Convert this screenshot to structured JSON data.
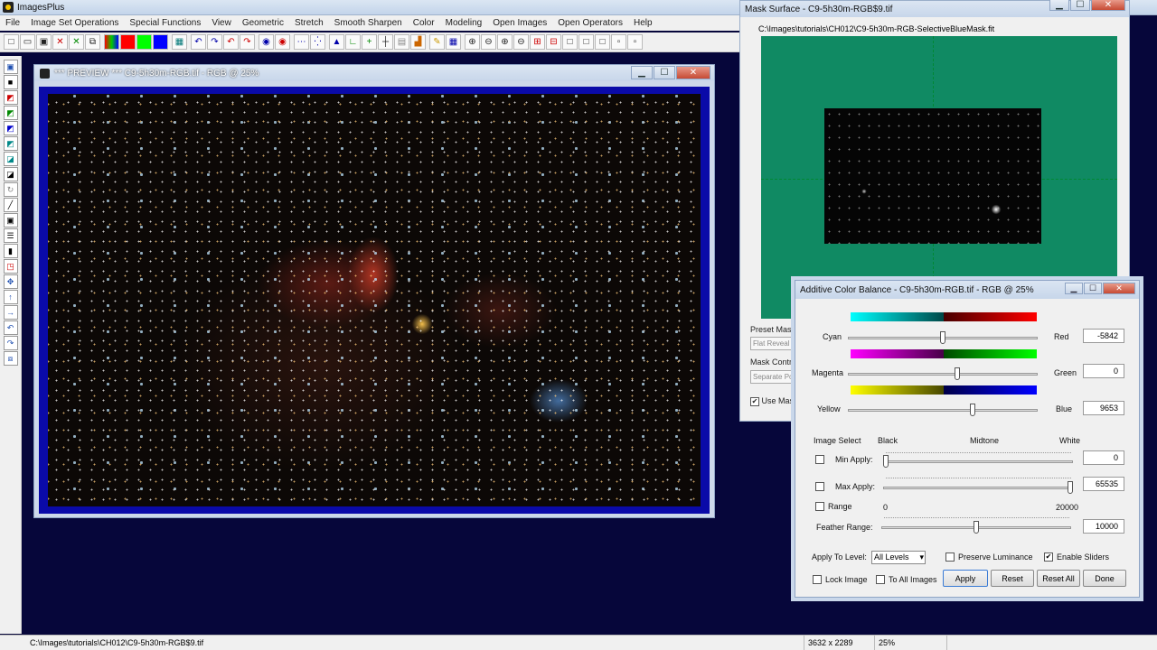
{
  "app": {
    "title": "ImagesPlus"
  },
  "menu": [
    "File",
    "Image Set Operations",
    "Special Functions",
    "View",
    "Geometric",
    "Stretch",
    "Smooth Sharpen",
    "Color",
    "Modeling",
    "Open Images",
    "Open Operators",
    "Help"
  ],
  "preview_window": {
    "title": "*** PREVIEW *** C9-5h30m-RGB.tif - RGB @ 25%",
    "controls": {
      "minimize": "▁",
      "maximize": "☐",
      "close": "✕"
    }
  },
  "mask_window": {
    "title": "Mask Surface - C9-5h30m-RGB$9.tif",
    "path": "C:\\Images\\tutorials\\CH012\\C9-5h30m-RGB-SelectiveBlueMask.fit",
    "preset_label": "Preset Mask",
    "preset_value": "Flat Reveal",
    "control_label": "Mask Control",
    "control_value": "Separate Po",
    "use_mask_label": "Use Mask",
    "use_mask_checked": "✔"
  },
  "color_balance": {
    "title": "Additive Color Balance - C9-5h30m-RGB.tif - RGB @ 25%",
    "controls": {
      "minimize": "▁",
      "maximize": "☐",
      "close": "✕"
    },
    "sliders": [
      {
        "left": "Cyan",
        "right": "Red",
        "value": "-5842",
        "level": 0.5
      },
      {
        "left": "Magenta",
        "right": "Green",
        "value": "0",
        "level": 0.58
      },
      {
        "left": "Yellow",
        "right": "Blue",
        "value": "9653",
        "level": 0.66
      }
    ],
    "image_select": "Image Select",
    "black": "Black",
    "midtone": "Midtone",
    "white": "White",
    "min_apply": {
      "label": "Min Apply:",
      "value": "0",
      "level": 0.0
    },
    "max_apply": {
      "label": "Max Apply:",
      "value": "65535",
      "level": 1.0
    },
    "range": {
      "label": "Range",
      "min": "0",
      "max": "20000"
    },
    "feather": {
      "label": "Feather Range:",
      "value": "10000",
      "level": 0.5
    },
    "apply_to_level_label": "Apply To Level:",
    "apply_to_level_value": "All Levels",
    "preserve_luminance": "Preserve Luminance",
    "enable_sliders": "Enable Sliders",
    "enable_sliders_checked": "✔",
    "lock_image": "Lock Image",
    "to_all_images": "To All Images",
    "buttons": {
      "apply": "Apply",
      "reset": "Reset",
      "reset_all": "Reset All",
      "done": "Done"
    }
  },
  "status": {
    "path": "C:\\Images\\tutorials\\CH012\\C9-5h30m-RGB$9.tif",
    "dimensions": "3632 x 2289",
    "zoom": "25%"
  }
}
